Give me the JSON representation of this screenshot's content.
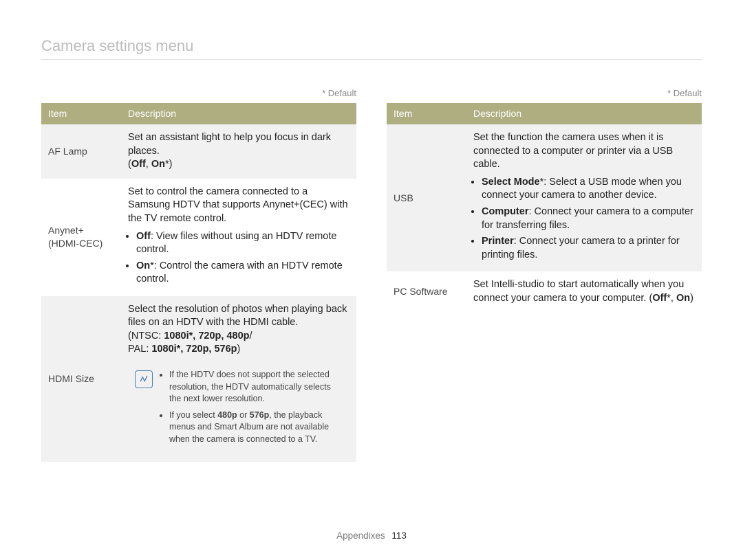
{
  "page": {
    "title": "Camera settings menu",
    "defaultNote": "* Default",
    "footerSection": "Appendixes",
    "footerPage": "113"
  },
  "headers": {
    "item": "Item",
    "description": "Description"
  },
  "left": {
    "rows": [
      {
        "item": "AF Lamp",
        "desc_line1": "Set an assistant light to help you focus in dark places.",
        "desc_line2_prefix": "(",
        "desc_line2_off": "Off",
        "desc_line2_sep": ", ",
        "desc_line2_on": "On",
        "desc_line2_suffix": "*)"
      },
      {
        "item": "Anynet+ (HDMI-CEC)",
        "desc_intro": "Set to control the camera connected to a Samsung HDTV that supports Anynet+(CEC) with the TV remote control.",
        "bullet1_label": "Off",
        "bullet1_text": ": View files without using an HDTV remote control.",
        "bullet2_label": "On",
        "bullet2_text": "*: Control the camera with an HDTV remote control."
      },
      {
        "item": "HDMI Size",
        "desc_intro": "Select the resolution of photos when playing back files on an HDTV with the HDMI cable.",
        "ntsc_prefix": "(NTSC: ",
        "ntsc_values": "1080i*, 720p, 480p",
        "ntsc_suffix": "/",
        "pal_prefix": "PAL: ",
        "pal_values": "1080i*, 720p, 576p",
        "pal_suffix": ")",
        "note1_a": "If the HDTV does not support the selected resolution, the HDTV automatically selects the next lower resolution.",
        "note2_a": "If you select ",
        "note2_b": "480p",
        "note2_c": " or ",
        "note2_d": "576p",
        "note2_e": ", the playback menus and Smart Album are not available when the camera is connected to a TV."
      }
    ]
  },
  "right": {
    "rows": [
      {
        "item": "USB",
        "desc_intro": "Set the function the camera uses when it is connected to a computer or printer via a USB cable.",
        "bullet1_label": "Select Mode",
        "bullet1_text": "*: Select a USB mode when you connect your camera to another device.",
        "bullet2_label": "Computer",
        "bullet2_text": ": Connect your camera to a computer for transferring files.",
        "bullet3_label": "Printer",
        "bullet3_text": ": Connect your camera to a printer for printing files."
      },
      {
        "item": "PC Software",
        "desc_text_a": "Set Intelli-studio to start automatically when you connect your camera to your computer. (",
        "desc_text_off": "Off",
        "desc_text_b": "*, ",
        "desc_text_on": "On",
        "desc_text_c": ")"
      }
    ]
  }
}
